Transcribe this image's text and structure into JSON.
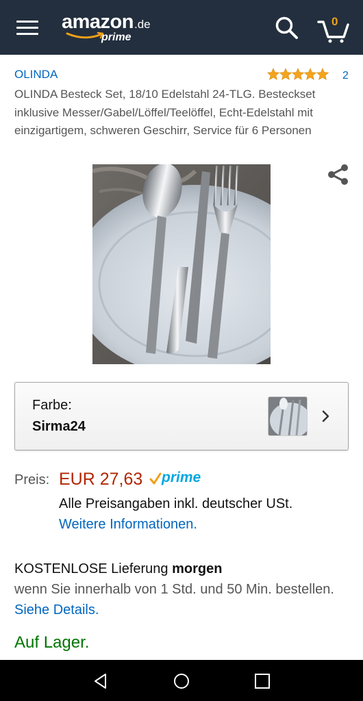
{
  "header": {
    "logo_word": "amazon",
    "logo_tld": ".de",
    "logo_sub": "prime",
    "cart_count": "0",
    "colors": {
      "bar": "#232f3e",
      "accent": "#f0a018"
    }
  },
  "product": {
    "brand": "OLINDA",
    "rating_stars": 5,
    "rating_count": "2",
    "title": "OLINDA Besteck Set, 18/10 Edelstahl 24-TLG. Besteckset inklusive Messer/Gabel/Löffel/Teelöffel, Echt-Edelstahl mit einzigartigem, schweren Geschirr, Service für 6 Personen"
  },
  "variation": {
    "label": "Farbe:",
    "value": "Sirma24"
  },
  "pricing": {
    "label": "Preis:",
    "price": "EUR 27,63",
    "prime_badge": "prime",
    "tax_note": "Alle Preisangaben inkl. deutscher USt.",
    "more_info_link": "Weitere Informationen."
  },
  "delivery": {
    "free_text": "KOSTENLOSE Lieferung",
    "day": "morgen",
    "condition": "wenn Sie innerhalb von 1 Std. und 50 Min. bestellen.",
    "details_link": "Siehe Details."
  },
  "stock": {
    "status": "Auf Lager."
  },
  "icons": [
    "menu-icon",
    "search-icon",
    "cart-icon",
    "star-icon",
    "share-icon",
    "chevron-right-icon",
    "nav-back-icon",
    "nav-home-icon",
    "nav-recents-icon"
  ]
}
